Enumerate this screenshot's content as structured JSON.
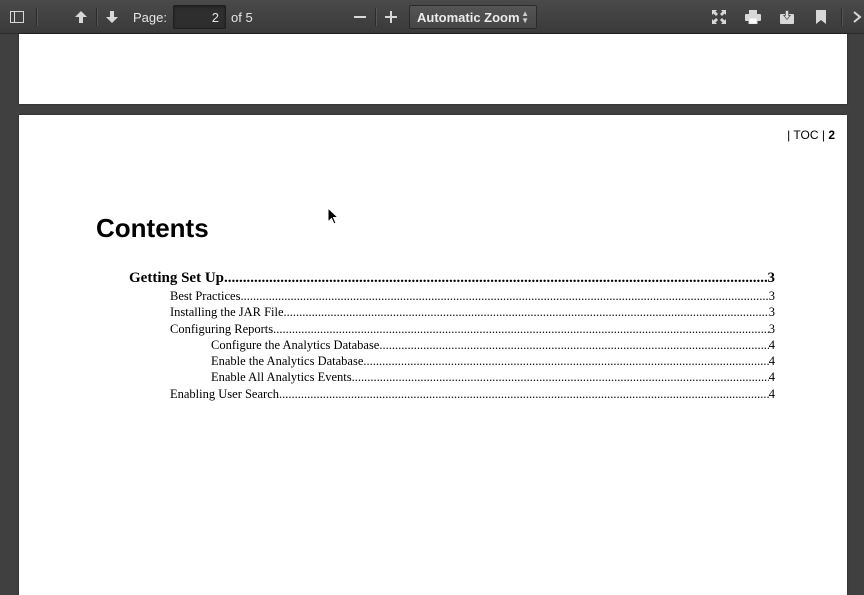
{
  "toolbar": {
    "sidebar_toggle_icon": "sidebar-icon",
    "prev_icon": "arrow-up-icon",
    "next_icon": "arrow-down-icon",
    "page_label": "Page:",
    "page_value": "2",
    "page_total": "of 5",
    "zoom_out_icon": "minus-icon",
    "zoom_in_icon": "plus-icon",
    "zoom_value": "Automatic Zoom",
    "right_icons": [
      "fullscreen-icon",
      "print-icon",
      "download-icon",
      "bookmark-icon",
      "more-tools-icon"
    ]
  },
  "document": {
    "header_prefix": "| TOC |",
    "header_page": "2",
    "title": "Contents",
    "toc": [
      {
        "level": 0,
        "text": "Getting Set Up",
        "page": "3"
      },
      {
        "level": 1,
        "text": "Best Practices",
        "page": "3"
      },
      {
        "level": 1,
        "text": "Installing the JAR File",
        "page": "3"
      },
      {
        "level": 1,
        "text": "Configuring Reports",
        "page": "3"
      },
      {
        "level": 2,
        "text": "Configure the Analytics Database",
        "page": "4"
      },
      {
        "level": 2,
        "text": "Enable the Analytics Database",
        "page": "4"
      },
      {
        "level": 2,
        "text": "Enable All Analytics Events",
        "page": "4"
      },
      {
        "level": 1,
        "text": "Enabling User Search",
        "page": "4"
      }
    ]
  }
}
